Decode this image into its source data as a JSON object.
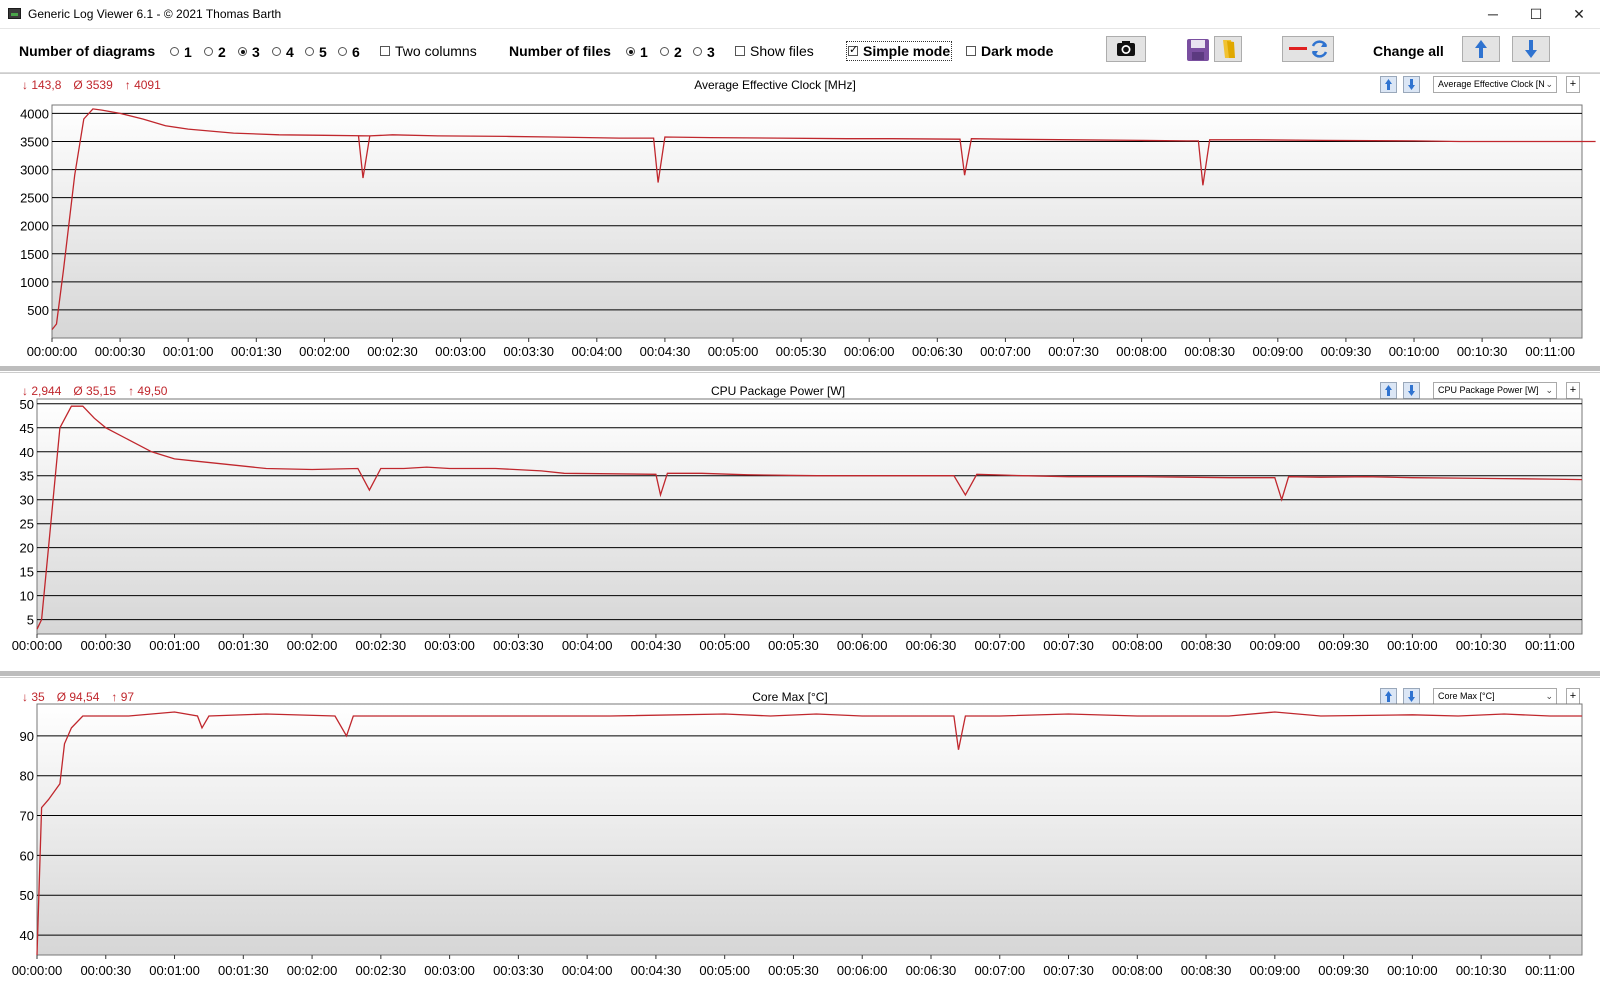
{
  "window": {
    "title": "Generic Log Viewer 6.1 - © 2021 Thomas Barth",
    "minimize_glyph": "─",
    "maximize_glyph": "☐",
    "close_glyph": "✕"
  },
  "toolbar": {
    "diagrams_label": "Number of diagrams",
    "diagram_options": [
      "1",
      "2",
      "3",
      "4",
      "5",
      "6"
    ],
    "diagram_selected": "3",
    "two_columns_label": "Two columns",
    "two_columns_checked": false,
    "files_label": "Number of files",
    "file_options": [
      "1",
      "2",
      "3"
    ],
    "file_selected": "1",
    "show_files_label": "Show files",
    "show_files_checked": false,
    "simple_mode_label": "Simple mode",
    "simple_mode_checked": true,
    "dark_mode_label": "Dark mode",
    "dark_mode_checked": false,
    "change_all_label": "Change all",
    "icons": [
      "camera-icon",
      "save-icon",
      "folder-icon",
      "remove-refresh-icon",
      "arrow-up-icon",
      "arrow-down-icon"
    ]
  },
  "colors": {
    "line": "#c0272d",
    "stats_text": "#c0272d",
    "grid": "#000000",
    "plot_top": "#ffffff",
    "plot_bottom": "#d6d6d6",
    "arrow_blue": "#2f73d0"
  },
  "panels": [
    {
      "stats": {
        "min": "↓ 143,8",
        "avg": "Ø 3539",
        "max": "↑ 4091"
      },
      "title": "Average Effective Clock [MHz]",
      "combo": "Average Effective Clock [N"
    },
    {
      "stats": {
        "min": "↓ 2,944",
        "avg": "Ø 35,15",
        "max": "↑ 49,50"
      },
      "title": "CPU Package Power [W]",
      "combo": "CPU Package Power [W]"
    },
    {
      "stats": {
        "min": "↓ 35",
        "avg": "Ø 94,54",
        "max": "↑ 97"
      },
      "title": "Core Max [°C]",
      "combo": "Core Max [°C]"
    }
  ],
  "chart_data": [
    {
      "type": "line",
      "title": "Average Effective Clock [MHz]",
      "x_unit": "seconds",
      "x_ticks": [
        "00:00:00",
        "00:00:30",
        "00:01:00",
        "00:01:30",
        "00:02:00",
        "00:02:30",
        "00:03:00",
        "00:03:30",
        "00:04:00",
        "00:04:30",
        "00:05:00",
        "00:05:30",
        "00:06:00",
        "00:06:30",
        "00:07:00",
        "00:07:30",
        "00:08:00",
        "00:08:30",
        "00:09:00",
        "00:09:30",
        "00:10:00",
        "00:10:30",
        "00:11:00"
      ],
      "y_ticks": [
        500,
        1000,
        1500,
        2000,
        2500,
        3000,
        3500,
        4000
      ],
      "ylim": [
        0,
        4150
      ],
      "xlim": [
        0,
        674
      ],
      "grid": true,
      "series": [
        {
          "x": [
            0,
            2,
            5,
            10,
            14,
            18,
            22,
            30,
            40,
            50,
            60,
            80,
            100,
            120,
            140,
            135,
            137,
            140,
            150,
            170,
            200,
            220,
            250,
            265,
            267,
            270,
            290,
            320,
            350,
            370,
            400,
            402,
            405,
            420,
            450,
            480,
            500,
            505,
            507,
            510,
            530,
            560,
            600,
            620,
            640,
            642,
            645,
            660,
            680
          ],
          "y": [
            150,
            250,
            1200,
            2900,
            3900,
            4080,
            4060,
            4000,
            3900,
            3780,
            3720,
            3650,
            3620,
            3610,
            3600,
            3600,
            2850,
            3600,
            3620,
            3600,
            3590,
            3580,
            3560,
            3560,
            2770,
            3580,
            3570,
            3560,
            3550,
            3550,
            3540,
            2900,
            3550,
            3540,
            3530,
            3520,
            3510,
            3510,
            2720,
            3530,
            3530,
            3520,
            3510,
            3500,
            3500,
            3500,
            3500,
            3500,
            3500
          ]
        }
      ]
    },
    {
      "type": "line",
      "title": "CPU Package Power [W]",
      "x_unit": "seconds",
      "x_ticks": [
        "00:00:00",
        "00:00:30",
        "00:01:00",
        "00:01:30",
        "00:02:00",
        "00:02:30",
        "00:03:00",
        "00:03:30",
        "00:04:00",
        "00:04:30",
        "00:05:00",
        "00:05:30",
        "00:06:00",
        "00:06:30",
        "00:07:00",
        "00:07:30",
        "00:08:00",
        "00:08:30",
        "00:09:00",
        "00:09:30",
        "00:10:00",
        "00:10:30",
        "00:11:00"
      ],
      "y_ticks": [
        5,
        10,
        15,
        20,
        25,
        30,
        35,
        40,
        45,
        50
      ],
      "ylim": [
        2,
        51
      ],
      "xlim": [
        0,
        674
      ],
      "grid": true,
      "series": [
        {
          "x": [
            0,
            2,
            5,
            10,
            15,
            20,
            25,
            30,
            40,
            50,
            60,
            70,
            80,
            100,
            120,
            140,
            145,
            150,
            160,
            170,
            180,
            200,
            220,
            230,
            270,
            272,
            275,
            290,
            310,
            340,
            400,
            405,
            410,
            430,
            450,
            480,
            520,
            540,
            543,
            546,
            560,
            580,
            600,
            620,
            640,
            660,
            674
          ],
          "y": [
            3,
            5,
            20,
            45,
            49.5,
            49.5,
            47,
            45,
            42.5,
            40,
            38.5,
            38,
            37.5,
            36.5,
            36.3,
            36.5,
            32,
            36.5,
            36.5,
            36.8,
            36.5,
            36.5,
            36,
            35.5,
            35.3,
            31,
            35.5,
            35.5,
            35.2,
            35.0,
            35.0,
            31,
            35.3,
            35.0,
            34.8,
            34.8,
            34.6,
            34.6,
            30,
            34.8,
            34.7,
            34.8,
            34.6,
            34.5,
            34.4,
            34.3,
            34.2
          ]
        }
      ]
    },
    {
      "type": "line",
      "title": "Core Max [°C]",
      "x_unit": "seconds",
      "x_ticks": [
        "00:00:00",
        "00:00:30",
        "00:01:00",
        "00:01:30",
        "00:02:00",
        "00:02:30",
        "00:03:00",
        "00:03:30",
        "00:04:00",
        "00:04:30",
        "00:05:00",
        "00:05:30",
        "00:06:00",
        "00:06:30",
        "00:07:00",
        "00:07:30",
        "00:08:00",
        "00:08:30",
        "00:09:00",
        "00:09:30",
        "00:10:00",
        "00:10:30",
        "00:11:00"
      ],
      "y_ticks": [
        40,
        50,
        60,
        70,
        80,
        90
      ],
      "ylim": [
        35,
        98
      ],
      "xlim": [
        0,
        674
      ],
      "grid": true,
      "series": [
        {
          "x": [
            0,
            2,
            5,
            10,
            12,
            15,
            20,
            40,
            60,
            70,
            72,
            75,
            100,
            130,
            135,
            138,
            140,
            170,
            200,
            250,
            300,
            320,
            340,
            360,
            400,
            402,
            405,
            420,
            450,
            480,
            500,
            520,
            540,
            560,
            600,
            620,
            640,
            660,
            674
          ],
          "y": [
            35,
            72,
            74,
            78,
            88,
            92,
            95,
            95,
            96,
            95,
            92,
            95,
            95.5,
            95,
            90,
            95,
            95,
            95,
            95,
            95,
            95.5,
            95,
            95.5,
            95,
            95,
            86.5,
            95,
            95,
            95.5,
            95,
            95,
            95,
            96,
            95,
            95.3,
            95,
            95.5,
            95,
            95
          ]
        }
      ]
    }
  ]
}
